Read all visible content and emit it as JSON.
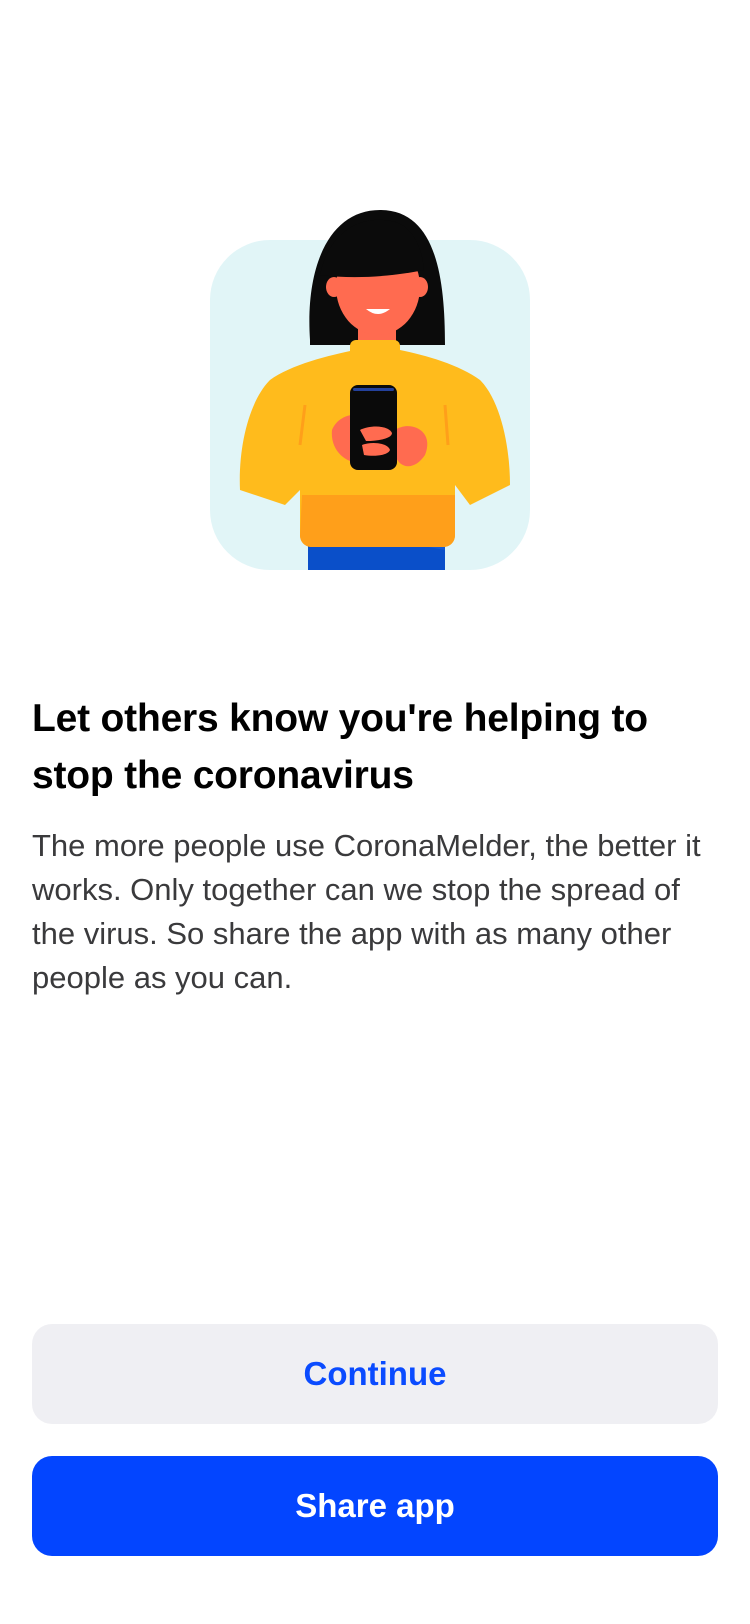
{
  "illustration": {
    "icon": "woman-with-phone-illustration",
    "colors": {
      "background": "#e1f5f7",
      "hair": "#0b0b0b",
      "skin": "#ff6b50",
      "sweater": "#ffbb1c",
      "sweater_shadow": "#ff9f1a",
      "phone": "#0a0a0a",
      "pants": "#0a4fc9"
    }
  },
  "main": {
    "title": "Let others know you're helping to stop the coronavirus",
    "body": "The more people use CoronaMelder, the better it works. Only together can we stop the spread of the virus. So share the app with as many other people as you can."
  },
  "actions": {
    "continue_label": "Continue",
    "share_label": "Share app"
  },
  "colors": {
    "accent": "#0345ff",
    "secondary_button_bg": "#efeff3"
  }
}
